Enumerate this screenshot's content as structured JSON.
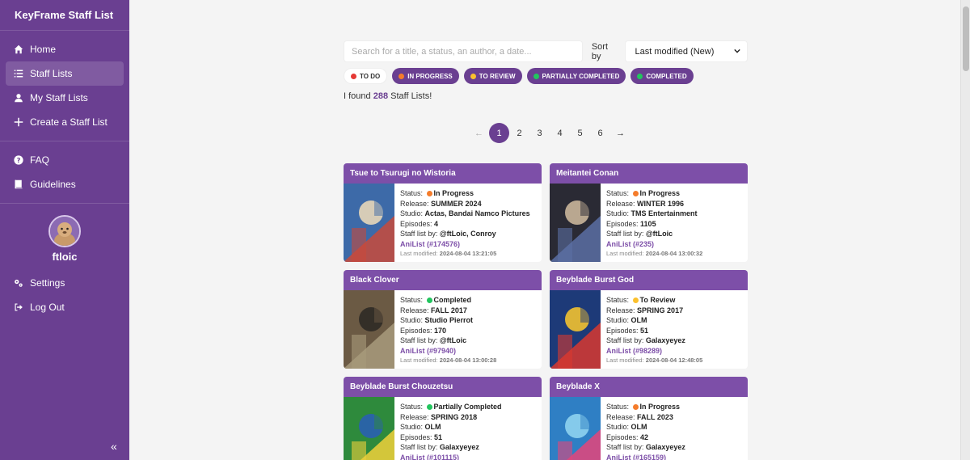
{
  "app": {
    "title": "KeyFrame Staff List",
    "username": "ftloic"
  },
  "sidebar": {
    "main_nav": [
      {
        "label": "Home",
        "icon": "home-icon"
      },
      {
        "label": "Staff Lists",
        "icon": "list-icon",
        "active": true
      },
      {
        "label": "My Staff Lists",
        "icon": "user-icon"
      },
      {
        "label": "Create a Staff List",
        "icon": "plus-icon"
      }
    ],
    "help_nav": [
      {
        "label": "FAQ",
        "icon": "question-icon"
      },
      {
        "label": "Guidelines",
        "icon": "book-icon"
      }
    ],
    "profile_nav": [
      {
        "label": "Settings",
        "icon": "gears-icon"
      },
      {
        "label": "Log Out",
        "icon": "logout-icon"
      }
    ],
    "collapse_label": "«"
  },
  "search": {
    "placeholder": "Search for a title, a status, an author, a date...",
    "sort_label": "Sort by",
    "sort_value": "Last modified (New)"
  },
  "filters": [
    {
      "label": "To Do",
      "color": "#e53935",
      "style": "plain"
    },
    {
      "label": "In Progress",
      "color": "#f57c2b",
      "style": "active"
    },
    {
      "label": "To Review",
      "color": "#fbc02d",
      "style": "active"
    },
    {
      "label": "Partially Completed",
      "color": "#22c55e",
      "style": "active"
    },
    {
      "label": "Completed",
      "color": "#22c55e",
      "style": "active"
    }
  ],
  "results": {
    "prefix": "I found",
    "count": "288",
    "suffix": "Staff Lists!"
  },
  "pagination": {
    "prev": "←",
    "pages": [
      "1",
      "2",
      "3",
      "4",
      "5",
      "6"
    ],
    "current": "1",
    "next": "→"
  },
  "labels": {
    "status": "Status:",
    "release": "Release:",
    "studio": "Studio:",
    "episodes": "Episodes:",
    "staff_by": "Staff list by:",
    "last_modified": "Last modified:"
  },
  "status_colors": {
    "In Progress": "#f57c2b",
    "Completed": "#22c55e",
    "To Review": "#fbc02d",
    "Partially Completed": "#22c55e"
  },
  "cards": [
    {
      "title": "Tsue to Tsurugi no Wistoria",
      "status": "In Progress",
      "release": "SUMMER 2024",
      "studio": "Actas, Bandai Namco Pictures",
      "episodes": "4",
      "staff_by": "@ftLoic, Conroy",
      "anilist": "AniList (#174576)",
      "last_modified": "2024-08-04 13:21:05",
      "poster_colors": [
        "#3d6aa8",
        "#c84a3b",
        "#e7d7b8"
      ]
    },
    {
      "title": "Meitantei Conan",
      "status": "In Progress",
      "release": "WINTER 1996",
      "studio": "TMS Entertainment",
      "episodes": "1105",
      "staff_by": "@ftLoic",
      "anilist": "AniList (#235)",
      "last_modified": "2024-08-04 13:00:32",
      "poster_colors": [
        "#2a2a34",
        "#5b6fa4",
        "#c9b59a"
      ]
    },
    {
      "title": "Black Clover",
      "status": "Completed",
      "release": "FALL 2017",
      "studio": "Studio Pierrot",
      "episodes": "170",
      "staff_by": "@ftLoic",
      "anilist": "AniList (#97940)",
      "last_modified": "2024-08-04 13:00:28",
      "poster_colors": [
        "#6b5a44",
        "#a89b7c",
        "#2f2a26"
      ]
    },
    {
      "title": "Beyblade Burst God",
      "status": "To Review",
      "release": "SPRING 2017",
      "studio": "OLM",
      "episodes": "51",
      "staff_by": "Galaxyeyez",
      "anilist": "AniList (#98289)",
      "last_modified": "2024-08-04 12:48:05",
      "poster_colors": [
        "#1d3a78",
        "#d8382f",
        "#f2c230"
      ]
    },
    {
      "title": "Beyblade Burst Chouzetsu",
      "status": "Partially Completed",
      "release": "SPRING 2018",
      "studio": "OLM",
      "episodes": "51",
      "staff_by": "Galaxyeyez",
      "anilist": "AniList (#101115)",
      "last_modified": "",
      "poster_colors": [
        "#2e8a3c",
        "#f0d03a",
        "#2a5fb0"
      ]
    },
    {
      "title": "Beyblade X",
      "status": "In Progress",
      "release": "FALL 2023",
      "studio": "OLM",
      "episodes": "42",
      "staff_by": "Galaxyeyez",
      "anilist": "AniList (#165159)",
      "last_modified": "",
      "poster_colors": [
        "#2f7fc4",
        "#e5447a",
        "#8fd3f0"
      ]
    }
  ]
}
